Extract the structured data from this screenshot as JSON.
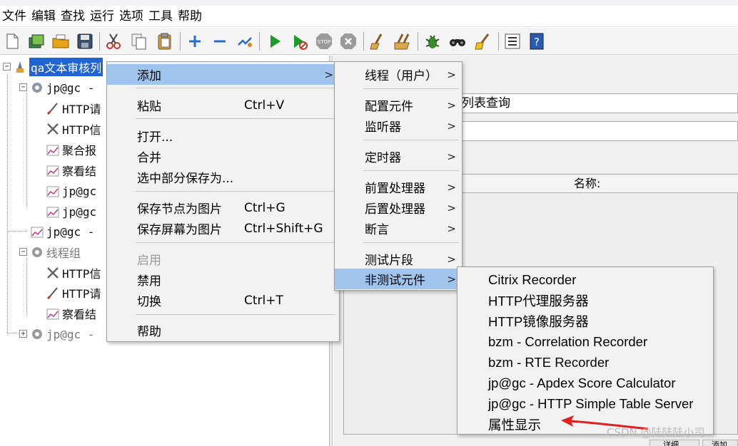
{
  "menubar": [
    "文件",
    "编辑",
    "查找",
    "运行",
    "选项",
    "工具",
    "帮助"
  ],
  "toolbar": {
    "icons": [
      "new-file-icon",
      "templates-icon",
      "open-icon",
      "save-icon",
      "cut-icon",
      "copy-icon",
      "paste-icon",
      "expand-icon",
      "collapse-icon",
      "toggle-icon",
      "start-icon",
      "start-no-pause-icon",
      "stop-icon",
      "shutdown-icon",
      "clear-icon",
      "clear-all-icon",
      "search-icon",
      "reset-search-icon",
      "function-helper-icon",
      "help-icon"
    ]
  },
  "tree": {
    "root": "qa文本审核列",
    "nodes": [
      {
        "label": "jp@gc -",
        "icon": "gear-icon"
      },
      {
        "label": "HTTP请",
        "icon": "pipette-icon"
      },
      {
        "label": "HTTP信",
        "icon": "tools-icon"
      },
      {
        "label": "聚合报",
        "icon": "graph-icon"
      },
      {
        "label": "察看结",
        "icon": "graph-icon"
      },
      {
        "label": "jp@gc",
        "icon": "graph-icon"
      },
      {
        "label": "jp@gc",
        "icon": "graph-icon"
      },
      {
        "label": "jp@gc -",
        "icon": "graph-icon"
      },
      {
        "label": "线程组",
        "icon": "gear-icon"
      },
      {
        "label": "HTTP信",
        "icon": "tools-icon"
      },
      {
        "label": "HTTP请",
        "icon": "pipette-icon"
      },
      {
        "label": "察看结",
        "icon": "graph-icon"
      },
      {
        "label": "jp@gc -",
        "icon": "gear-icon"
      }
    ]
  },
  "right_panel": {
    "name_value": "列表查询",
    "column_header": "名称:",
    "bottom_tabs": [
      "详细",
      "添加"
    ]
  },
  "context_menu": {
    "items": [
      {
        "label": "添加",
        "submenu": true
      },
      {
        "label": "粘贴",
        "shortcut": "Ctrl+V"
      },
      {
        "label": "打开..."
      },
      {
        "label": "合并"
      },
      {
        "label": "选中部分保存为..."
      },
      {
        "label": "保存节点为图片",
        "shortcut": "Ctrl+G"
      },
      {
        "label": "保存屏幕为图片",
        "shortcut": "Ctrl+Shift+G"
      },
      {
        "label": "启用",
        "disabled": true
      },
      {
        "label": "禁用"
      },
      {
        "label": "切换",
        "shortcut": "Ctrl+T"
      },
      {
        "label": "帮助"
      }
    ]
  },
  "add_submenu": {
    "items": [
      "线程（用户）",
      "配置元件",
      "监听器",
      "定时器",
      "前置处理器",
      "后置处理器",
      "断言",
      "测试片段",
      "非测试元件"
    ]
  },
  "non_test_submenu": {
    "items": [
      "Citrix Recorder",
      "HTTP代理服务器",
      "HTTP镜像服务器",
      "bzm - Correlation Recorder",
      "bzm - RTE Recorder",
      "jp@gc - Apdex Score Calculator",
      "jp@gc - HTTP Simple Table Server",
      "属性显示"
    ]
  },
  "annotation": {
    "arrow_color": "#e02020"
  },
  "watermark": "CSDN @陆陆陆小司",
  "colors": {
    "selection": "#1f64d2",
    "menu_highlight": "#9fc5ef",
    "menu_bg": "#f2f2f2"
  }
}
